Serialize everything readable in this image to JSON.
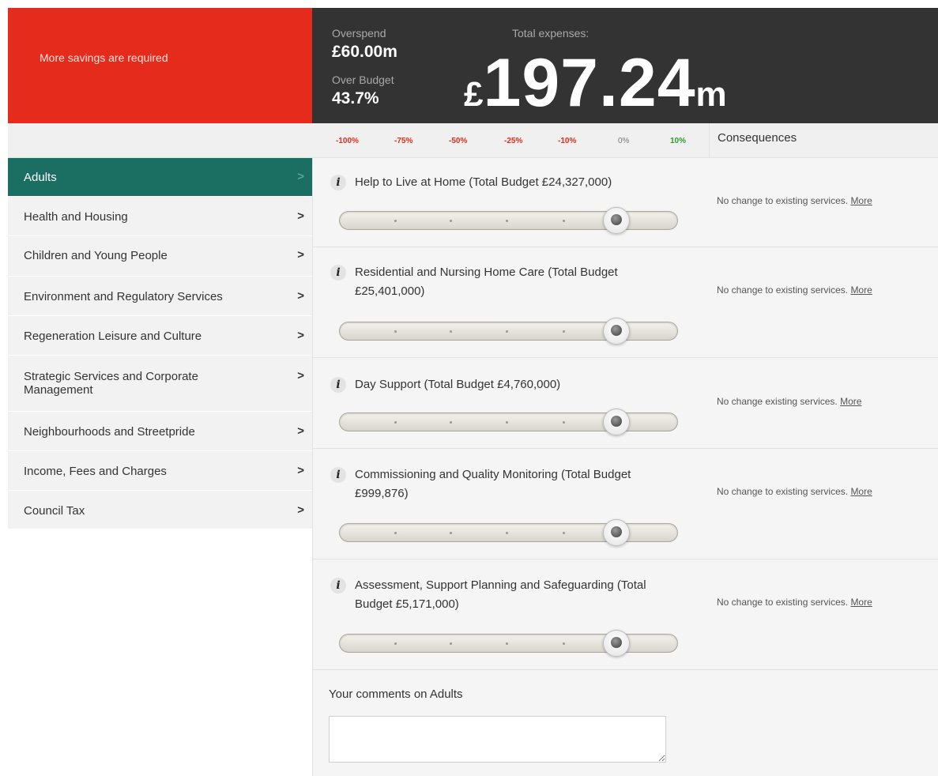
{
  "header": {
    "alert_text": "More savings are required",
    "overspend_label": "Overspend",
    "overspend_value": "£60.00m",
    "over_budget_label": "Over Budget",
    "over_budget_value": "43.7%",
    "total_label": "Total expenses:",
    "total_currency": "£",
    "total_value": "197.24",
    "total_unit": "m"
  },
  "scale": {
    "labels": [
      "-100%",
      "-75%",
      "-50%",
      "-25%",
      "-10%",
      "0%",
      "10%"
    ],
    "colors": {
      "negative": "#e52b1b",
      "zero": "#777777",
      "positive": "#2e9a2e"
    },
    "consequences_header": "Consequences"
  },
  "sidebar": {
    "items": [
      {
        "label": "Adults",
        "active": true
      },
      {
        "label": "Health and Housing"
      },
      {
        "label": "Children and Young People"
      },
      {
        "label": "Environment and Regulatory Services"
      },
      {
        "label": "Regeneration Leisure and Culture"
      },
      {
        "label": "Strategic Services and Corporate Management"
      },
      {
        "label": "Neighbourhoods and Streetpride"
      },
      {
        "label": "Income, Fees and Charges"
      },
      {
        "label": "Council Tax"
      }
    ],
    "chevron": ">"
  },
  "items": [
    {
      "info": "i",
      "title": "Help to Live at Home (Total Budget £24,327,000)",
      "consequence": "No change to existing services.",
      "more": "More",
      "slider_value": "0%"
    },
    {
      "info": "i",
      "title": "Residential and Nursing Home Care (Total Budget £25,401,000)",
      "consequence": "No change to existing services.",
      "more": "More",
      "slider_value": "0%"
    },
    {
      "info": "i",
      "title": "Day Support (Total Budget £4,760,000)",
      "consequence": "No change existing services.",
      "more": "More",
      "slider_value": "0%"
    },
    {
      "info": "i",
      "title": "Commissioning and Quality Monitoring (Total Budget £999,876)",
      "consequence": "No change to existing services.",
      "more": "More",
      "slider_value": "0%"
    },
    {
      "info": "i",
      "title": "Assessment, Support Planning and Safeguarding (Total Budget £5,171,000)",
      "consequence": "No change to existing services.",
      "more": "More",
      "slider_value": "0%"
    }
  ],
  "comments": {
    "label": "Your comments on Adults",
    "value": ""
  },
  "colors": {
    "alert": "#e52b1b",
    "active_nav": "#1a6e62",
    "header_bg": "#333333"
  }
}
